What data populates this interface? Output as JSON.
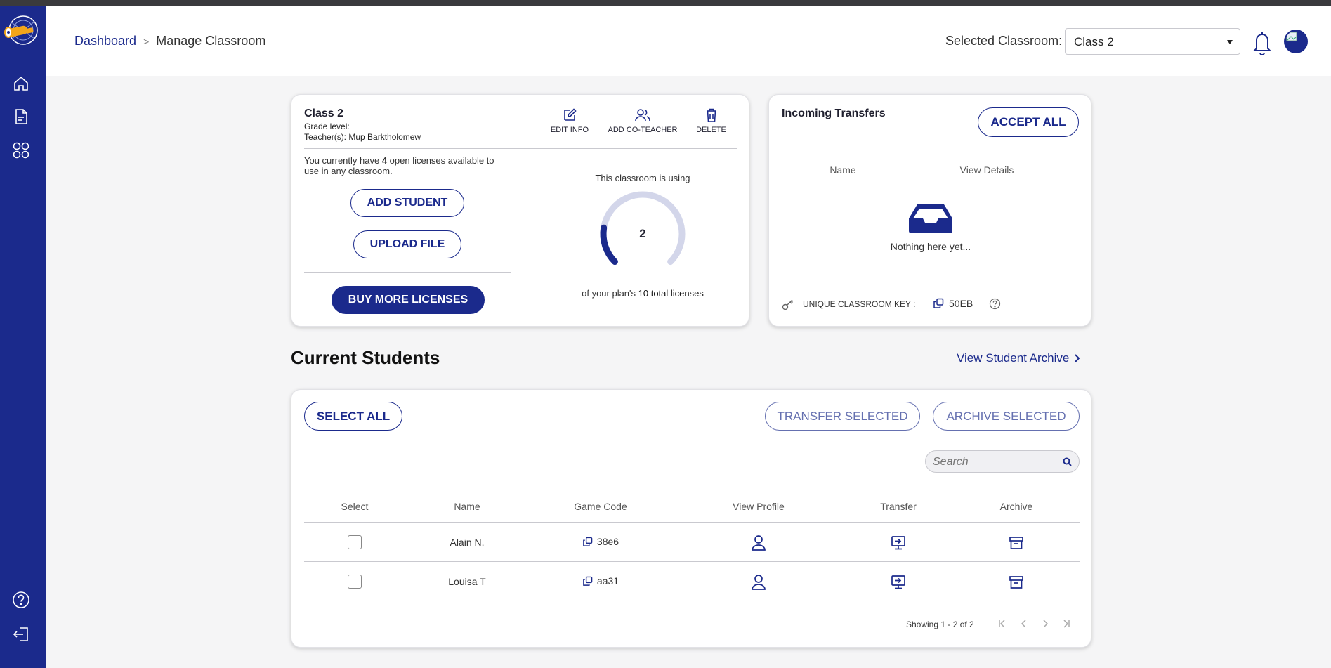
{
  "breadcrumb": {
    "home": "Dashboard",
    "separator": ">",
    "current": "Manage Classroom"
  },
  "header": {
    "selected_label": "Selected Classroom:",
    "selected_value": "Class 2"
  },
  "class_card": {
    "title": "Class 2",
    "grade_label": "Grade level:",
    "teacher_label": "Teacher(s):",
    "teacher_name": "Mup Barktholomew",
    "actions": {
      "edit": "EDIT INFO",
      "co_teacher": "ADD CO-TEACHER",
      "delete": "DELETE"
    },
    "license_text_pre": "You currently have ",
    "license_count": "4",
    "license_text_post": " open licenses available to use in any classroom.",
    "add_student": "ADD STUDENT",
    "upload_file": "UPLOAD FILE",
    "buy_more": "BUY MORE LICENSES",
    "usage_label": "This classroom is using",
    "usage_value": 2,
    "usage_total": 10,
    "usage_value_text": "2",
    "plan_text_pre": "of your plan's ",
    "plan_text_bold": "10 total licenses"
  },
  "transfers_card": {
    "title": "Incoming Transfers",
    "accept_all": "ACCEPT ALL",
    "col_name": "Name",
    "col_details": "View Details",
    "empty_text": "Nothing here yet...",
    "key_label": "UNIQUE CLASSROOM KEY :",
    "key_value": "50EB"
  },
  "students": {
    "heading": "Current Students",
    "archive_link": "View Student Archive",
    "select_all": "SELECT ALL",
    "transfer_selected": "TRANSFER SELECTED",
    "archive_selected": "ARCHIVE SELECTED",
    "search_placeholder": "Search",
    "columns": [
      "Select",
      "Name",
      "Game Code",
      "View Profile",
      "Transfer",
      "Archive"
    ],
    "rows": [
      {
        "name": "Alain N.",
        "code": "38e6"
      },
      {
        "name": "Louisa T",
        "code": "aa31"
      }
    ],
    "pagination": "Showing 1 - 2 of 2"
  },
  "colors": {
    "brand": "#1b2a8c",
    "gauge_track": "#d3d6ea"
  }
}
